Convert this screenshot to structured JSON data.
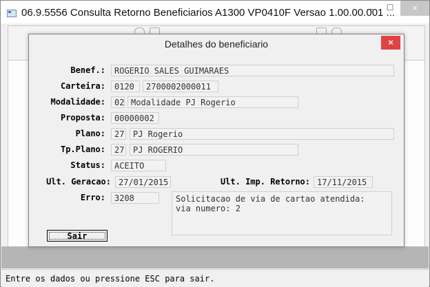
{
  "window": {
    "title": "06.9.5556  Consulta Retorno Beneficiarios A1300 VP0410F Versao 1.00.00.001 ...",
    "minimize_glyph": "–",
    "maximize_glyph": "□",
    "close_glyph": "×"
  },
  "dialog": {
    "title": "Detalhes do beneficiario",
    "close_glyph": "×",
    "fields": {
      "benef": {
        "label": "Benef.:",
        "value": "ROGERIO SALES GUIMARAES"
      },
      "carteira": {
        "label": "Carteira:",
        "value1": "0120",
        "value2": "2700002000011"
      },
      "modalidade": {
        "label": "Modalidade:",
        "code": "02",
        "value": "Modalidade PJ Rogerio"
      },
      "proposta": {
        "label": "Proposta:",
        "value": "00000002"
      },
      "plano": {
        "label": "Plano:",
        "code": "27",
        "value": "PJ Rogerio"
      },
      "tp_plano": {
        "label": "Tp.Plano:",
        "code": "27",
        "value": "PJ ROGERIO"
      },
      "status": {
        "label": "Status:",
        "value": "ACEITO"
      },
      "ult_geracao": {
        "label": "Ult. Geracao:",
        "value": "27/01/2015"
      },
      "ult_imp_retorno": {
        "label": "Ult. Imp. Retorno:",
        "value": "17/11/2015"
      },
      "erro": {
        "label": "Erro:",
        "code": "3208",
        "message": "Solicitacao de via de cartao atendida:\nvia numero: 2"
      }
    },
    "sair_label": "Sair"
  },
  "statusbar": {
    "text": "Entre os dados ou pressione ESC para sair."
  }
}
